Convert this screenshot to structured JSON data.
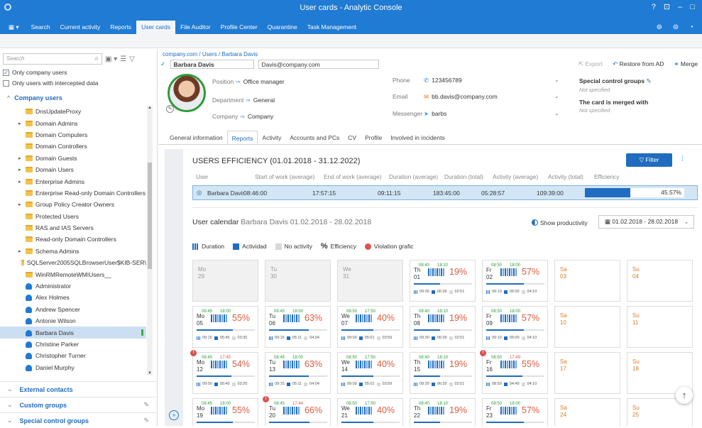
{
  "window": {
    "title": "User cards - Analytic Console",
    "controls": "? ⊡ – □"
  },
  "menu": [
    "Search",
    "Current activity",
    "Reports",
    "User cards",
    "File Auditor",
    "Profile Center",
    "Quarantine",
    "Task Management"
  ],
  "menu_active": "User cards",
  "left": {
    "search_placeholder": "Search",
    "only_company_users": "Only company users",
    "only_intercepted": "Only users with intercepted data",
    "company_users": "Company users",
    "tree": [
      {
        "label": "DnsUpdateProxy",
        "type": "folder",
        "exp": ""
      },
      {
        "label": "Domain Admins",
        "type": "folder",
        "exp": "▸"
      },
      {
        "label": "Domain Computers",
        "type": "folder",
        "exp": ""
      },
      {
        "label": "Domain Controllers",
        "type": "folder",
        "exp": ""
      },
      {
        "label": "Domain Guests",
        "type": "folder",
        "exp": "▸"
      },
      {
        "label": "Domain Users",
        "type": "folder",
        "exp": "▸"
      },
      {
        "label": "Enterprise Admins",
        "type": "folder",
        "exp": "▸"
      },
      {
        "label": "Enterprise Read-only Domain Controllers",
        "type": "folder",
        "exp": ""
      },
      {
        "label": "Group Policy Creator Owners",
        "type": "folder",
        "exp": "▸"
      },
      {
        "label": "Protected Users",
        "type": "folder",
        "exp": ""
      },
      {
        "label": "RAS and IAS Servers",
        "type": "folder",
        "exp": ""
      },
      {
        "label": "Read-only Domain Controllers",
        "type": "folder",
        "exp": ""
      },
      {
        "label": "Schema Admins",
        "type": "folder",
        "exp": "▸"
      },
      {
        "label": "SQLServer2005SQLBrowserUser$KIB-SER\\",
        "type": "folder",
        "exp": ""
      },
      {
        "label": "WinRMRemoteWMIUsers__",
        "type": "folder",
        "exp": ""
      },
      {
        "label": "Administrator",
        "type": "user",
        "exp": ""
      },
      {
        "label": "Alex Holmes",
        "type": "user",
        "exp": ""
      },
      {
        "label": "Andrew Spencer",
        "type": "user",
        "exp": ""
      },
      {
        "label": "Antonie Wilson",
        "type": "user",
        "exp": ""
      },
      {
        "label": "Barbara Davis",
        "type": "user",
        "exp": "",
        "selected": true
      },
      {
        "label": "Christine Parker",
        "type": "user",
        "exp": ""
      },
      {
        "label": "Christopher Turner",
        "type": "user",
        "exp": ""
      },
      {
        "label": "Daniel Murphy",
        "type": "user",
        "exp": ""
      },
      {
        "label": "David Brown",
        "type": "user",
        "exp": ""
      }
    ],
    "external_contacts": "External contacts",
    "custom_groups": "Custom groups",
    "special_control_groups": "Special control groups"
  },
  "card": {
    "breadcrumb": "company.com / Users / Barbara Davis",
    "name": "Barbara Davis",
    "email_main": "Davis@company.com",
    "export": "Export",
    "restore": "Restore from AD",
    "merge": "Merge",
    "position_label": "Position",
    "position": "Office manager",
    "department_label": "Department",
    "department": "General",
    "company_label": "Company",
    "company": "Company",
    "phone_label": "Phone",
    "phone": "123456789",
    "email_label": "Email",
    "email": "bb.davis@company.com",
    "messenger_label": "Messenger",
    "messenger": "barbs",
    "scg_title": "Special control groups",
    "scg_value": "Not specified",
    "merged_title": "The card is merged with",
    "merged_value": "Not specified"
  },
  "tabs": [
    "General information",
    "Reports",
    "Activity",
    "Accounts and PCs",
    "CV",
    "Profile",
    "Involved in incidents"
  ],
  "tab_active": "Reports",
  "efficiency": {
    "title": "USERS EFFICIENCY (01.01.2018 - 31.12.2022)",
    "filter": "Filter",
    "columns": [
      "User",
      "Start of work (average)",
      "End of work (average)",
      "Duration (average)",
      "Duration (total)",
      "Activity (average)",
      "Activity (total)",
      "Efficiency"
    ],
    "row": {
      "user": "Barbara Davis",
      "start": "08:46:00",
      "end": "17:57:15",
      "dur_avg": "09:11:15",
      "dur_total": "183:45:00",
      "act_avg": "05:28:57",
      "act_total": "109:39:00",
      "eff_label": "45.57%",
      "eff_value": 45.57
    }
  },
  "calendar": {
    "title": "User calendar",
    "subtitle": "Barbara Davis 01.02.2018 - 28.02.2018",
    "show_productivity": "Show productivity",
    "date_range": "01.02.2018 - 28.02.2018",
    "legend": {
      "duration": "Duration",
      "activity": "Actividad",
      "no_activity": "No activity",
      "efficiency": "Efficiency",
      "violation": "Violation grafic"
    },
    "days": [
      {
        "kind": "empty",
        "name": "Mo",
        "num": "29"
      },
      {
        "kind": "empty",
        "name": "Tu",
        "num": "30"
      },
      {
        "kind": "empty",
        "name": "We",
        "num": "31"
      },
      {
        "kind": "work",
        "name": "Th",
        "num": "01",
        "start": "08:40",
        "end": "18:10",
        "pct": "19%",
        "fill": 0.45,
        "d": "09:30",
        "a": "06:39",
        "n": "02:51"
      },
      {
        "kind": "work",
        "name": "Fr",
        "num": "02",
        "start": "08:50",
        "end": "18:00",
        "pct": "57%",
        "fill": 0.65,
        "d": "09:10",
        "a": "05:00",
        "n": "04:10"
      },
      {
        "kind": "weekend",
        "name": "Sa",
        "num": "03"
      },
      {
        "kind": "weekend",
        "name": "Su",
        "num": "04"
      },
      {
        "kind": "work",
        "name": "Mo",
        "num": "05",
        "start": "08:45",
        "end": "18:00",
        "pct": "55%",
        "fill": 0.62,
        "d": "09:15",
        "a": "05:45",
        "n": "03:30"
      },
      {
        "kind": "work",
        "name": "Tu",
        "num": "06",
        "start": "08:45",
        "end": "18:00",
        "pct": "63%",
        "fill": 0.68,
        "d": "09:15",
        "a": "05:11",
        "n": "04:04"
      },
      {
        "kind": "work",
        "name": "We",
        "num": "07",
        "start": "08:50",
        "end": "17:50",
        "pct": "40%",
        "fill": 0.55,
        "d": "09:00",
        "a": "05:01",
        "n": "03:59"
      },
      {
        "kind": "work",
        "name": "Th",
        "num": "08",
        "start": "08:40",
        "end": "18:10",
        "pct": "19%",
        "fill": 0.45,
        "d": "09:30",
        "a": "06:39",
        "n": "02:51"
      },
      {
        "kind": "work",
        "name": "Fr",
        "num": "09",
        "start": "08:50",
        "end": "18:00",
        "pct": "57%",
        "fill": 0.65,
        "d": "09:10",
        "a": "05:00",
        "n": "04:10"
      },
      {
        "kind": "weekend",
        "name": "Sa",
        "num": "10"
      },
      {
        "kind": "weekend",
        "name": "Su",
        "num": "11"
      },
      {
        "kind": "work",
        "name": "Mo",
        "num": "12",
        "start": "08:45",
        "end": "17:45",
        "pct": "54%",
        "fill": 0.6,
        "d": "09:00",
        "a": "05:40",
        "n": "03:20",
        "viol": true,
        "late": true
      },
      {
        "kind": "work",
        "name": "Tu",
        "num": "13",
        "start": "08:45",
        "end": "18:00",
        "pct": "63%",
        "fill": 0.68,
        "d": "09:15",
        "a": "05:11",
        "n": "04:04"
      },
      {
        "kind": "work",
        "name": "We",
        "num": "14",
        "start": "08:50",
        "end": "17:50",
        "pct": "40%",
        "fill": 0.55,
        "d": "09:00",
        "a": "05:01",
        "n": "03:59"
      },
      {
        "kind": "work",
        "name": "Th",
        "num": "15",
        "start": "08:40",
        "end": "18:10",
        "pct": "19%",
        "fill": 0.45,
        "d": "09:30",
        "a": "06:39",
        "n": "02:51"
      },
      {
        "kind": "work",
        "name": "Fr",
        "num": "16",
        "start": "08:50",
        "end": "17:49",
        "pct": "55%",
        "fill": 0.62,
        "d": "08:59",
        "a": "04:49",
        "n": "04:10",
        "viol": true,
        "late": true
      },
      {
        "kind": "weekend",
        "name": "Sa",
        "num": "17"
      },
      {
        "kind": "weekend",
        "name": "Su",
        "num": "18"
      },
      {
        "kind": "work",
        "name": "Mo",
        "num": "19",
        "start": "08:45",
        "end": "18:00",
        "pct": "55%",
        "fill": 0.62,
        "d": "",
        "a": "",
        "n": ""
      },
      {
        "kind": "work",
        "name": "Tu",
        "num": "20",
        "start": "08:45",
        "end": "17:44",
        "pct": "66%",
        "fill": 0.7,
        "d": "",
        "a": "",
        "n": "",
        "viol": true,
        "late": true
      },
      {
        "kind": "work",
        "name": "We",
        "num": "21",
        "start": "08:50",
        "end": "17:50",
        "pct": "40%",
        "fill": 0.55,
        "d": "",
        "a": "",
        "n": ""
      },
      {
        "kind": "work",
        "name": "Th",
        "num": "22",
        "start": "08:40",
        "end": "18:10",
        "pct": "19%",
        "fill": 0.45,
        "d": "",
        "a": "",
        "n": ""
      },
      {
        "kind": "work",
        "name": "Fr",
        "num": "23",
        "start": "08:50",
        "end": "18:00",
        "pct": "57%",
        "fill": 0.65,
        "d": "",
        "a": "",
        "n": ""
      },
      {
        "kind": "weekend",
        "name": "Sa",
        "num": "24"
      },
      {
        "kind": "weekend",
        "name": "Su",
        "num": "25"
      }
    ]
  },
  "colors": {
    "accent": "#1f7bd3",
    "header": "#1f6cc0",
    "danger": "#d9534f",
    "weekend": "#e07b22",
    "ok": "#2e9b3a"
  }
}
